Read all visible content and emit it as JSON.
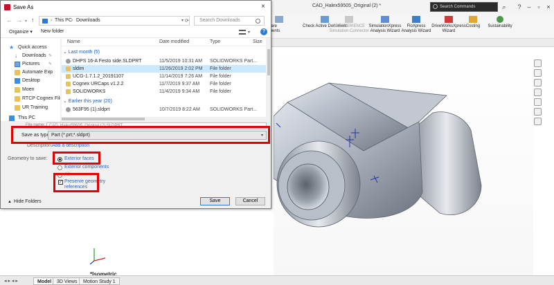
{
  "solidworks": {
    "title": "CAD_Halex59505_Original (2) *",
    "search_placeholder": "Search Commands",
    "ribbon": [
      {
        "label": "pare\nments"
      },
      {
        "label": "Check Active Document"
      },
      {
        "label": "3DEXPERIENCE\nSimulation Connector"
      },
      {
        "label": "SimulationXpress\nAnalysis Wizard"
      },
      {
        "label": "FloXpress\nAnalysis Wizard"
      },
      {
        "label": "DriveWorksXpress\nWizard"
      },
      {
        "label": "Costing"
      },
      {
        "label": "Sustainability"
      }
    ],
    "view_label": "*Isometric",
    "bottom_tabs": [
      "Model",
      "3D Views",
      "Motion Study 1"
    ],
    "colors": {
      "accent": "#e00000",
      "selection": "#cce8ff",
      "link": "#2a64c8"
    }
  },
  "dialog": {
    "title": "Save As",
    "breadcrumbs": [
      "This PC",
      "Downloads"
    ],
    "search_placeholder": "Search Downloads",
    "toolbar": {
      "organize": "Organize ▾",
      "new_folder": "New folder"
    },
    "nav_items": [
      {
        "label": "Quick access",
        "icon": "star-icon"
      },
      {
        "label": "Downloads",
        "icon": "download-icon"
      },
      {
        "label": "Pictures",
        "icon": "pictures-icon"
      },
      {
        "label": "Automate Exp",
        "icon": "folder-icon"
      },
      {
        "label": "Desktop",
        "icon": "desktop-icon"
      },
      {
        "label": "Moen",
        "icon": "folder-icon"
      },
      {
        "label": "RTCP Cognex File",
        "icon": "folder-icon"
      },
      {
        "label": "UR Training",
        "icon": "folder-icon"
      },
      {
        "label": "This PC",
        "icon": "pc-icon"
      }
    ],
    "columns": {
      "name": "Name",
      "date": "Date modified",
      "type": "Type",
      "size": "Size"
    },
    "groups": [
      {
        "label": "Last month (5)",
        "rows": [
          {
            "name": "DHPS 16-A Festo side.SLDPRT",
            "date": "11/5/2019 10:31 AM",
            "type": "SOLIDWORKS Part...",
            "icon": "part"
          },
          {
            "name": "sldim",
            "date": "11/26/2019 2:02 PM",
            "type": "File folder",
            "icon": "folder"
          },
          {
            "name": "UCG-1.7.1.2_20191107",
            "date": "11/14/2019 7:26 AM",
            "type": "File folder",
            "icon": "folder"
          },
          {
            "name": "Cognex URCaps v1.2.2",
            "date": "11/7/2019 9:37 AM",
            "type": "File folder",
            "icon": "folder"
          },
          {
            "name": "SOLIDWORKS",
            "date": "11/4/2019 9:34 AM",
            "type": "File folder",
            "icon": "folder"
          }
        ]
      },
      {
        "label": "Earlier this year (20)",
        "rows": [
          {
            "name": "563F95 (1).sldprt",
            "date": "10/7/2019 8:22 AM",
            "type": "SOLIDWORKS Part...",
            "icon": "part"
          }
        ]
      }
    ],
    "file_name_label": "File name:",
    "file_name_value": "CAD_Halex59505_Original (2).SLDPRT",
    "save_type_label": "Save as type:",
    "save_type_value": "Part (*.prt;*.sldprt)",
    "description_label": "Description:",
    "description_link": "Add a description",
    "geometry_label": "Geometry to save:",
    "options": {
      "exterior_faces": "Exterior faces",
      "exterior_components": "Exterior components",
      "all": "All",
      "preserve": "Preserve geometry\nreferences"
    },
    "hide_folders": "Hide Folders",
    "save_button": "Save",
    "cancel_button": "Cancel"
  }
}
